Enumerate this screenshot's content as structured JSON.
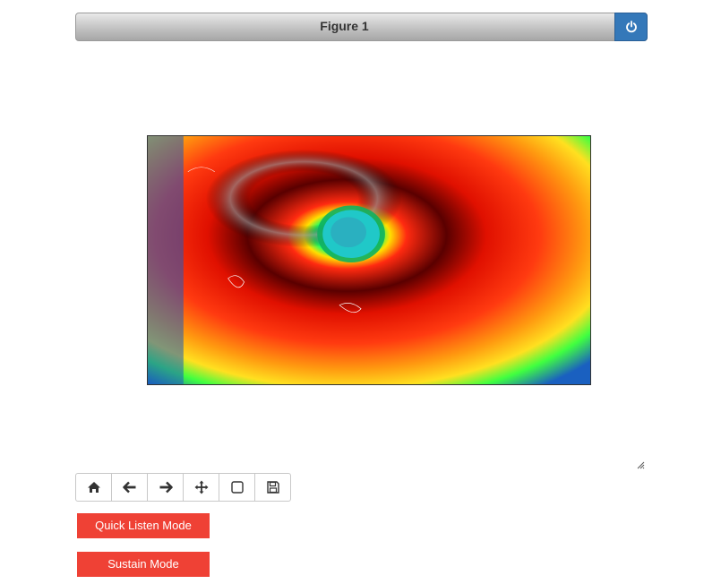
{
  "figure": {
    "title": "Figure 1",
    "power_icon": "power-icon",
    "image_description_icon": "hurricane-satellite-image"
  },
  "toolbar": {
    "buttons": [
      {
        "icon": "home-icon"
      },
      {
        "icon": "back-arrow-icon"
      },
      {
        "icon": "forward-arrow-icon"
      },
      {
        "icon": "pan-move-icon"
      },
      {
        "icon": "zoom-rectangle-icon"
      },
      {
        "icon": "save-icon"
      }
    ]
  },
  "modes": {
    "quick_listen_label": "Quick Listen Mode",
    "sustain_label": "Sustain Mode"
  },
  "colors": {
    "mode_button": "#ef4135",
    "power_button": "#3478b9"
  }
}
